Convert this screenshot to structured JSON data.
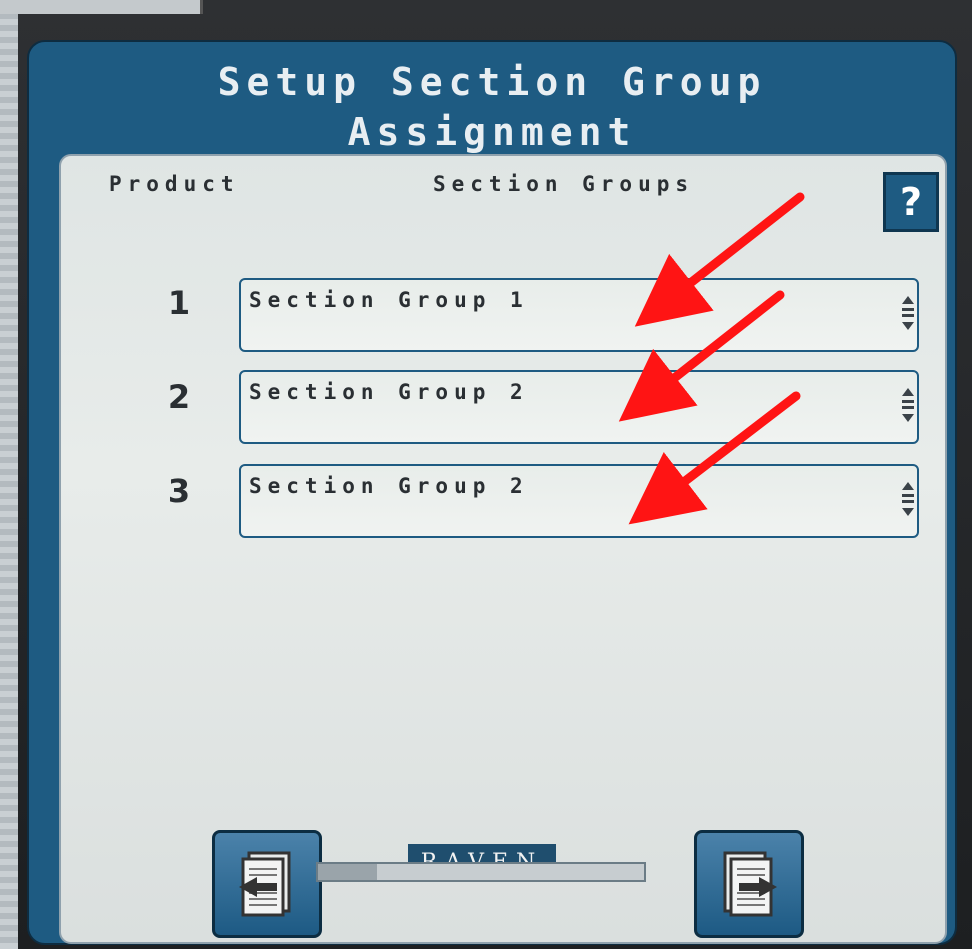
{
  "title": {
    "line1": "Setup Section Group",
    "line2": "Assignment"
  },
  "headers": {
    "product": "Product",
    "section_groups": "Section Groups"
  },
  "help_label": "?",
  "rows": [
    {
      "product": "1",
      "section_group": "Section Group 1"
    },
    {
      "product": "2",
      "section_group": "Section Group 2"
    },
    {
      "product": "3",
      "section_group": "Section Group 2"
    }
  ],
  "brand": "RAVEN",
  "progress": {
    "fraction": 0.18
  },
  "colors": {
    "accent": "#1e5b82",
    "annotation": "#ff1414"
  },
  "icons": {
    "back": "back-page-icon",
    "next": "next-page-icon",
    "scroll": "up-down-arrows-icon"
  }
}
